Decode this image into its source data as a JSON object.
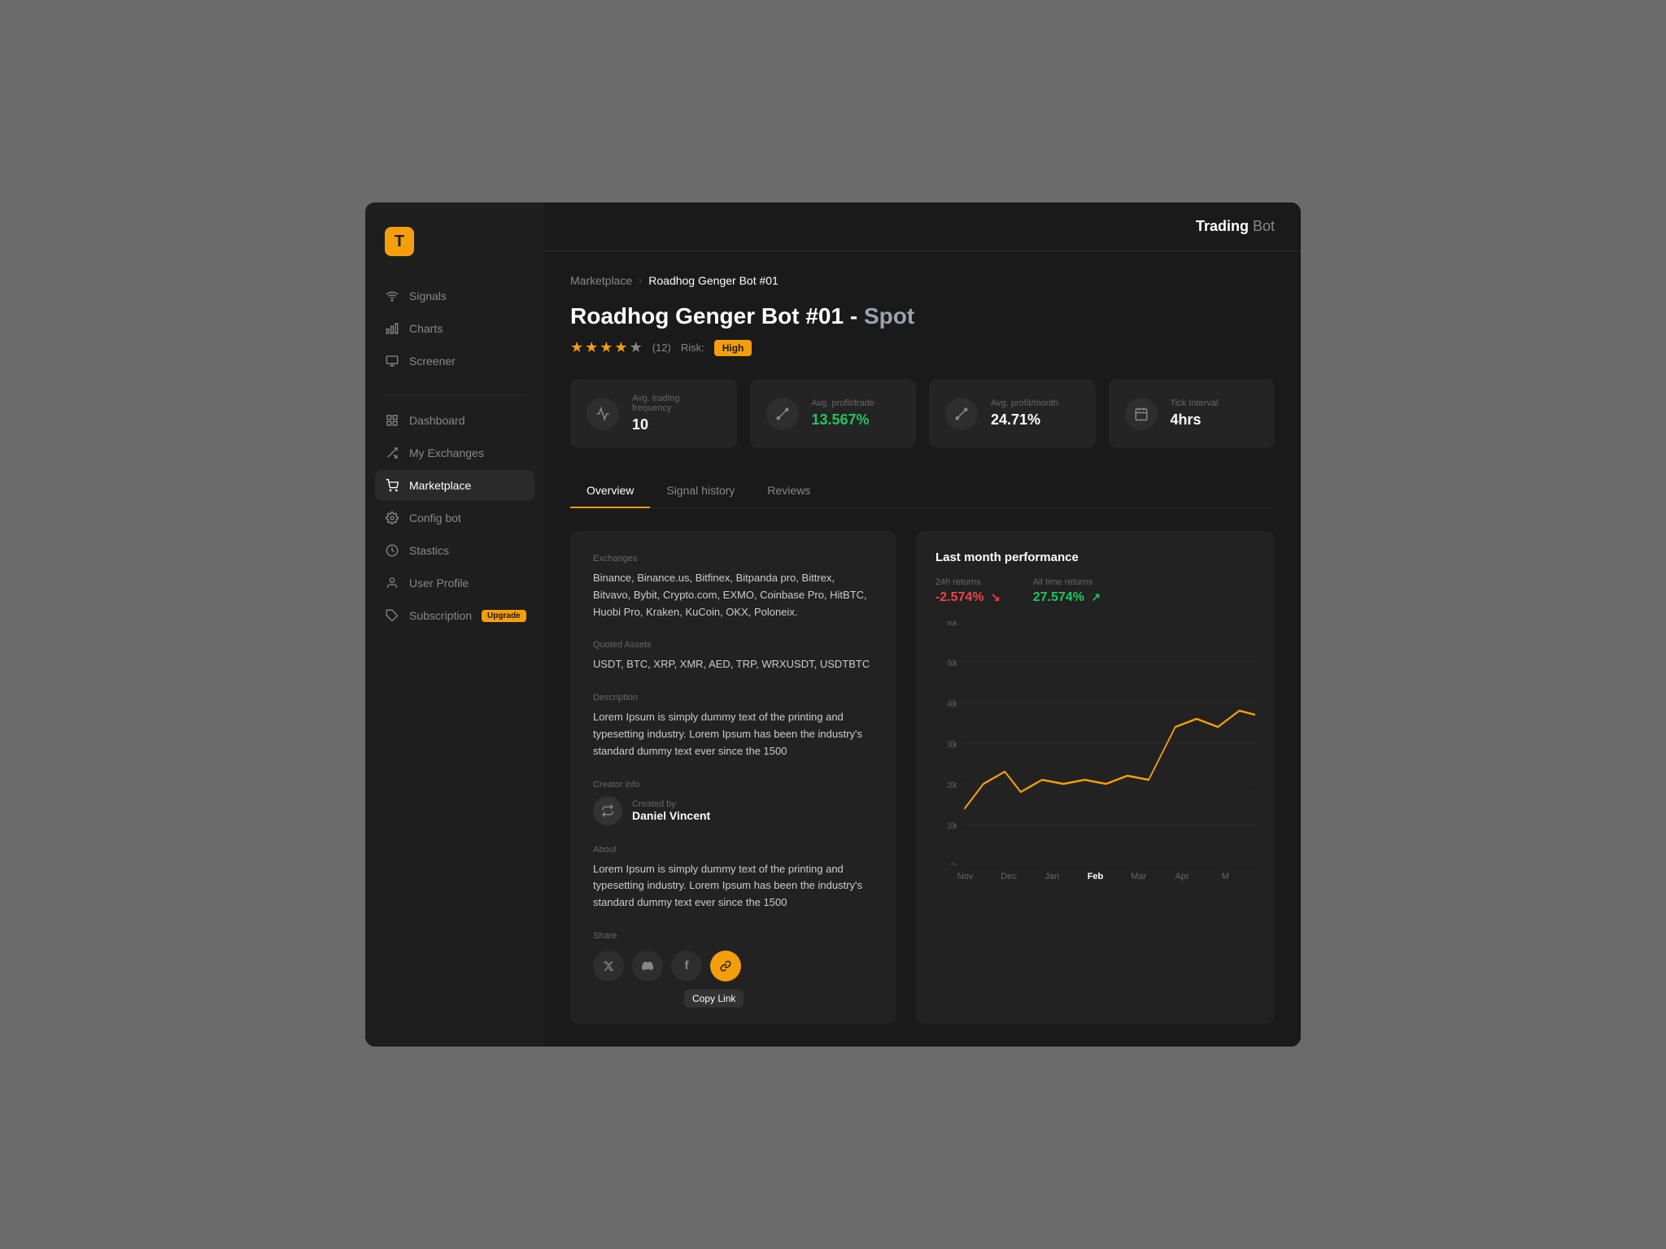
{
  "app": {
    "title": "Trading",
    "title_sub": "Bot"
  },
  "sidebar": {
    "logo_char": "T",
    "items": [
      {
        "id": "signals",
        "label": "Signals",
        "icon": "wifi"
      },
      {
        "id": "charts",
        "label": "Charts",
        "icon": "bar-chart"
      },
      {
        "id": "screener",
        "label": "Screener",
        "icon": "monitor"
      },
      {
        "id": "dashboard",
        "label": "Dashboard",
        "icon": "grid"
      },
      {
        "id": "my-exchanges",
        "label": "My Exchanges",
        "icon": "shuffle"
      },
      {
        "id": "marketplace",
        "label": "Marketplace",
        "icon": "shopping-cart",
        "active": true
      },
      {
        "id": "config-bot",
        "label": "Config bot",
        "icon": "settings"
      },
      {
        "id": "stastics",
        "label": "Stastics",
        "icon": "clock"
      },
      {
        "id": "user-profile",
        "label": "User Profile",
        "icon": "user"
      },
      {
        "id": "subscription",
        "label": "Subscription",
        "icon": "tag",
        "badge": "Upgrade"
      }
    ]
  },
  "breadcrumb": {
    "parent": "Marketplace",
    "current": "Roadhog Genger Bot #01"
  },
  "bot": {
    "name": "Roadhog Genger Bot #01",
    "type": "Spot",
    "title_dash": "-",
    "rating": 4,
    "rating_count": "(12)",
    "risk_label": "Risk:",
    "risk_value": "High",
    "stats": [
      {
        "icon": "activity",
        "label": "Avg. trading frequency",
        "value": "10",
        "green": false
      },
      {
        "icon": "percent",
        "label": "Avg. profit/trade",
        "value": "13.567%",
        "green": true
      },
      {
        "icon": "percent",
        "label": "Avg. profit/month",
        "value": "24.71%",
        "green": false
      },
      {
        "icon": "calendar",
        "label": "Tick Interval",
        "value": "4hrs",
        "green": false
      }
    ]
  },
  "tabs": [
    {
      "id": "overview",
      "label": "Overview",
      "active": true
    },
    {
      "id": "signal-history",
      "label": "Signal history",
      "active": false
    },
    {
      "id": "reviews",
      "label": "Reviews",
      "active": false
    }
  ],
  "overview": {
    "exchanges_label": "Exchanges",
    "exchanges_value": "Binance, Binance.us, Bitfinex, Bitpanda pro, Bittrex, Bitvavo, Bybit, Crypto.com, EXMO, Coinbase Pro, HitBTC, Huobi Pro, Kraken, KuCoin, OKX, Poloneix.",
    "quoted_assets_label": "Quoted Assets",
    "quoted_assets_value": "USDT, BTC, XRP, XMR, AED, TRP, WRXUSDT, USDTBTC",
    "description_label": "Description",
    "description_value": "Lorem Ipsum is simply dummy text of the printing and typesetting industry. Lorem Ipsum has been the industry's standard dummy text ever since the 1500",
    "creator_info_label": "Creator  info",
    "created_by_label": "Created by",
    "creator_name": "Daniel Vincent",
    "about_label": "About",
    "about_value": "Lorem Ipsum is simply dummy text of the printing and typesetting industry. Lorem Ipsum has been the industry's standard dummy text ever since the 1500",
    "share_label": "Share",
    "share_buttons": [
      {
        "id": "twitter",
        "icon": "𝕏",
        "color": "default"
      },
      {
        "id": "discord",
        "icon": "💬",
        "color": "default"
      },
      {
        "id": "facebook",
        "icon": "f",
        "color": "default"
      },
      {
        "id": "copy-link",
        "icon": "🔗",
        "color": "orange"
      }
    ],
    "copy_tooltip": "Copy Link"
  },
  "chart": {
    "title": "Last month performance",
    "returns_24h_label": "24h returns",
    "returns_24h_value": "-2.574%",
    "all_time_label": "All time returns",
    "all_time_value": "27.574%",
    "y_labels": [
      "60k",
      "50k",
      "40k",
      "30k",
      "20k",
      "10k",
      "0k"
    ],
    "x_labels": [
      "Nov",
      "Dec",
      "Jan",
      "Feb",
      "Mar",
      "Apr",
      "M"
    ],
    "x_bold": "Feb"
  }
}
